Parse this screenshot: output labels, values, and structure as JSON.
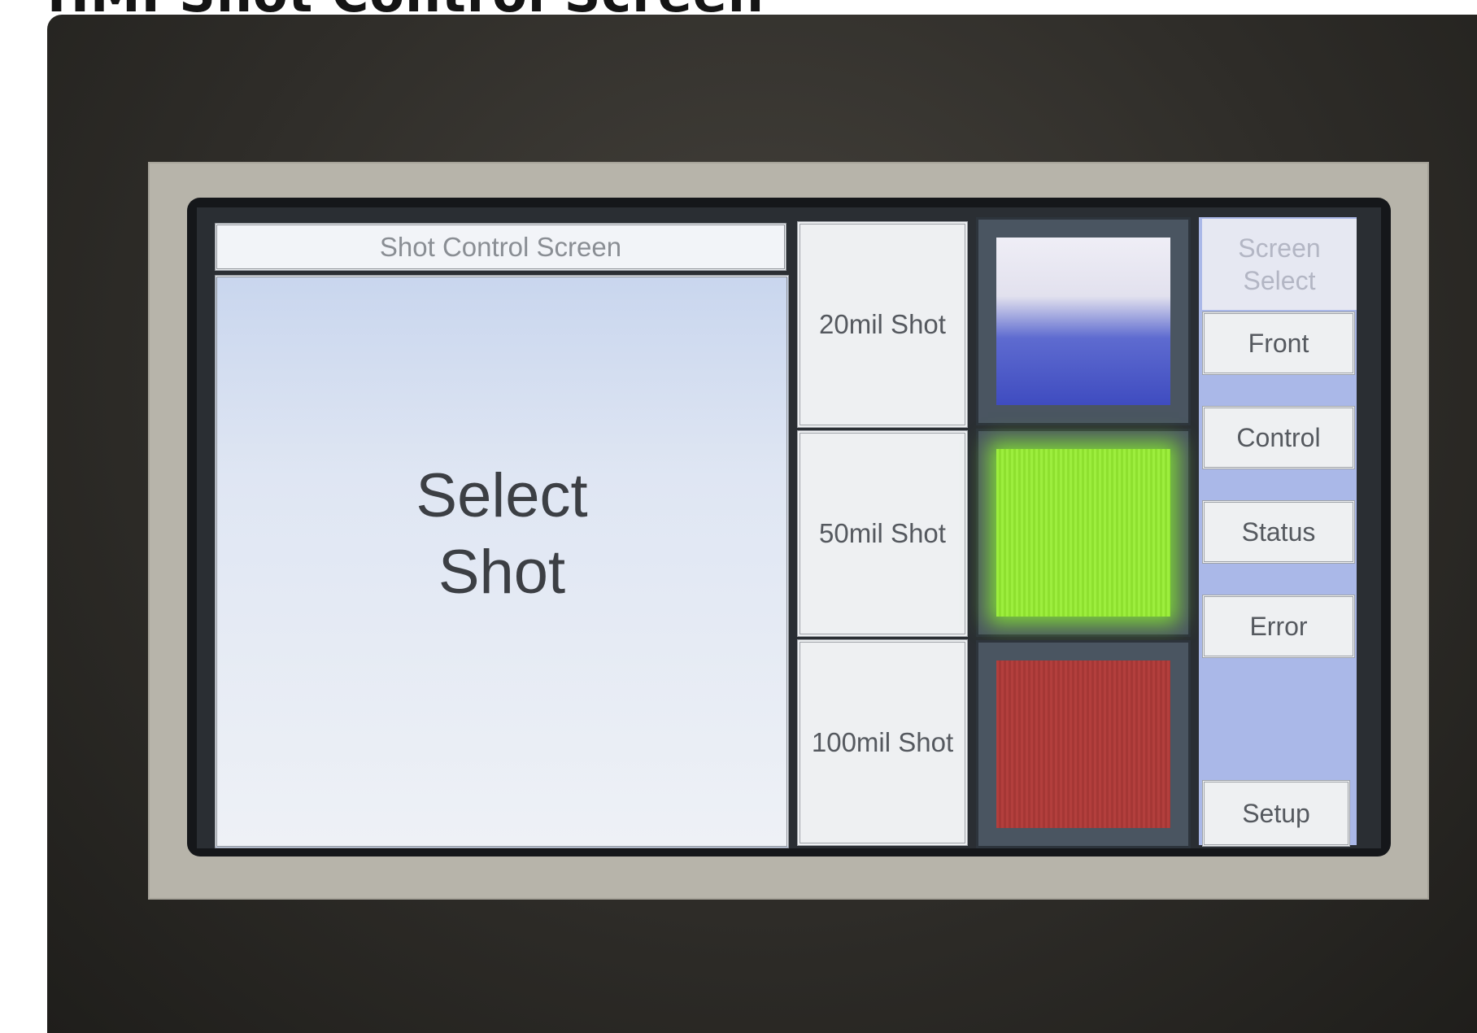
{
  "page_heading": "HMI Shot Control Screen",
  "hmi": {
    "title": "Shot Control Screen",
    "message": "Select\nShot",
    "shot_buttons": [
      "20mil Shot",
      "50mil Shot",
      "100mil Shot"
    ],
    "indicators": [
      {
        "name": "blue-indicator",
        "color": "#3f4cc0"
      },
      {
        "name": "green-indicator",
        "color": "#9dee3e"
      },
      {
        "name": "red-indicator",
        "color": "#b33f3d"
      }
    ],
    "screen_select": {
      "header": "Screen\nSelect",
      "items": [
        "Front",
        "Control",
        "Status",
        "Error"
      ],
      "setup": "Setup"
    }
  }
}
